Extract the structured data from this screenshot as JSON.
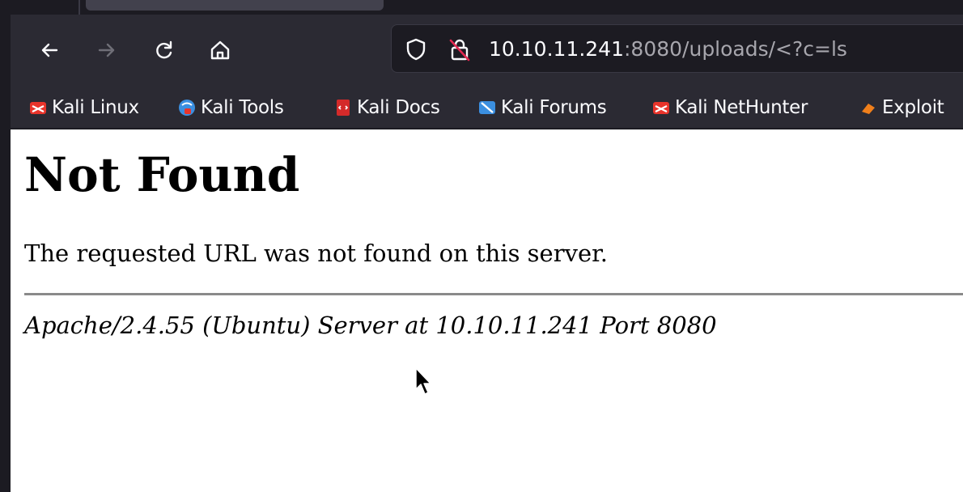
{
  "browser": {
    "url": {
      "host": "10.10.11.241",
      "rest": ":8080/uploads/<?c=ls"
    },
    "nav_icons": [
      "back-icon",
      "forward-icon",
      "reload-icon",
      "home-icon"
    ],
    "url_icons": [
      "shield-icon",
      "insecure-lock-icon"
    ],
    "bookmarks": [
      {
        "label": "Kali Linux",
        "icon": "kali-dragon-icon",
        "color": "#e8342b"
      },
      {
        "label": "Kali Tools",
        "icon": "kali-tools-icon",
        "color": "#3b8fe0"
      },
      {
        "label": "Kali Docs",
        "icon": "kali-docs-icon",
        "color": "#d42a2a"
      },
      {
        "label": "Kali Forums",
        "icon": "kali-forums-icon",
        "color": "#3b8fe0"
      },
      {
        "label": "Kali NetHunter",
        "icon": "kali-nethunter-icon",
        "color": "#e8342b"
      },
      {
        "label": "Exploit",
        "icon": "exploit-db-icon",
        "color": "#f07f1b"
      }
    ]
  },
  "page": {
    "heading": "Not Found",
    "message": "The requested URL was not found on this server.",
    "server_signature": "Apache/2.4.55 (Ubuntu) Server at 10.10.11.241 Port 8080"
  },
  "theme": {
    "chrome_bg": "#2b2a33",
    "urlbar_bg": "#1c1b22",
    "text_light": "#fbfbfe",
    "text_dim": "#a7a6ad"
  }
}
